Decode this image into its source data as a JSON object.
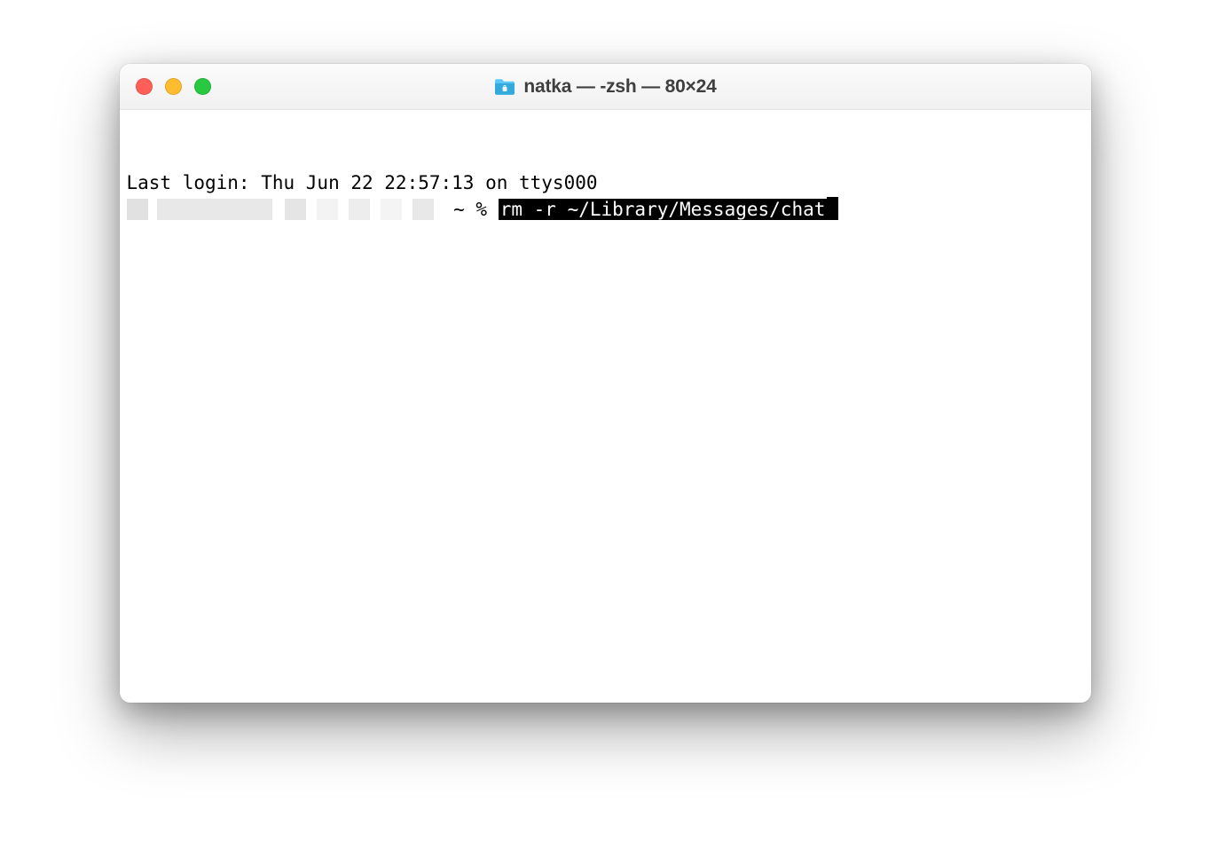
{
  "window": {
    "title": "natka — -zsh — 80×24"
  },
  "terminal": {
    "last_login_line": "Last login: Thu Jun 22 22:57:13 on ttys000",
    "prompt_symbol": " ~ % ",
    "command_highlighted": "rm -r ~/Library/Messages/chat"
  }
}
